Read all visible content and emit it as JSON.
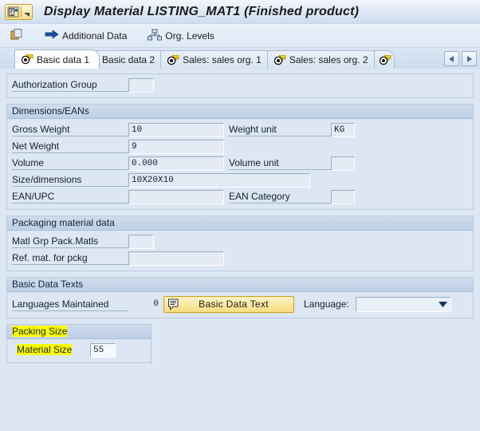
{
  "window": {
    "title": "Display Material LISTING_MAT1 (Finished product)",
    "sysmenu_icon": "sap-menu-icon",
    "sysmenu_caret": "caret-down-icon"
  },
  "toolbar": {
    "items": [
      {
        "label": "",
        "icon": "copy-icon",
        "name": "toolbar-copy-button"
      },
      {
        "label": "Additional Data",
        "icon": "right-arrow-icon",
        "name": "toolbar-additional-data-button"
      },
      {
        "label": "Org. Levels",
        "icon": "org-levels-icon",
        "name": "toolbar-org-levels-button"
      }
    ]
  },
  "tabs": {
    "items": [
      {
        "label": "Basic data 1",
        "active": true,
        "icon": "tab-marker-icon"
      },
      {
        "label": "Basic data 2",
        "active": false,
        "icon": ""
      },
      {
        "label": "Sales: sales org. 1",
        "active": false,
        "icon": "tab-marker-icon"
      },
      {
        "label": "Sales: sales org. 2",
        "active": false,
        "icon": "tab-marker-icon"
      },
      {
        "label": "",
        "active": false,
        "icon": "tab-marker-icon"
      }
    ],
    "nav_prev": "◄",
    "nav_next": "►"
  },
  "sections": {
    "authorization": {
      "rows": [
        {
          "label": "Authorization Group",
          "value": ""
        }
      ]
    },
    "dimensions": {
      "header": "Dimensions/EANs",
      "gross_weight_label": "Gross Weight",
      "gross_weight_value": "10",
      "weight_unit_label": "Weight unit",
      "weight_unit_value": "KG",
      "net_weight_label": "Net Weight",
      "net_weight_value": "9",
      "volume_label": "Volume",
      "volume_value": "0.000",
      "volume_unit_label": "Volume unit",
      "volume_unit_value": "",
      "size_label": "Size/dimensions",
      "size_value": "10X20X10",
      "ean_label": "EAN/UPC",
      "ean_value": "",
      "ean_category_label": "EAN Category",
      "ean_category_value": ""
    },
    "packaging": {
      "header": "Packaging material data",
      "matl_grp_label": "Matl Grp Pack.Matls",
      "matl_grp_value": "",
      "ref_mat_label": "Ref. mat. for pckg",
      "ref_mat_value": ""
    },
    "basic_data_texts": {
      "header": "Basic Data Texts",
      "languages_label": "Languages Maintained",
      "languages_count": "0",
      "button_label": "Basic Data Text",
      "button_icon": "text-document-icon",
      "language_label": "Language:",
      "language_value": "",
      "dropdown_icon": "chevron-down-icon"
    },
    "packing_size": {
      "header": "Packing Size",
      "material_size_label": "Material Size",
      "material_size_value": "55",
      "highlight_color": "#ffff00"
    }
  },
  "colors": {
    "background": "#dce7f3",
    "group_header": "#c5d4e7",
    "field_fill": "#e3ebf5",
    "button_yellow": "#fbe9a2",
    "highlight": "#ffff00"
  }
}
